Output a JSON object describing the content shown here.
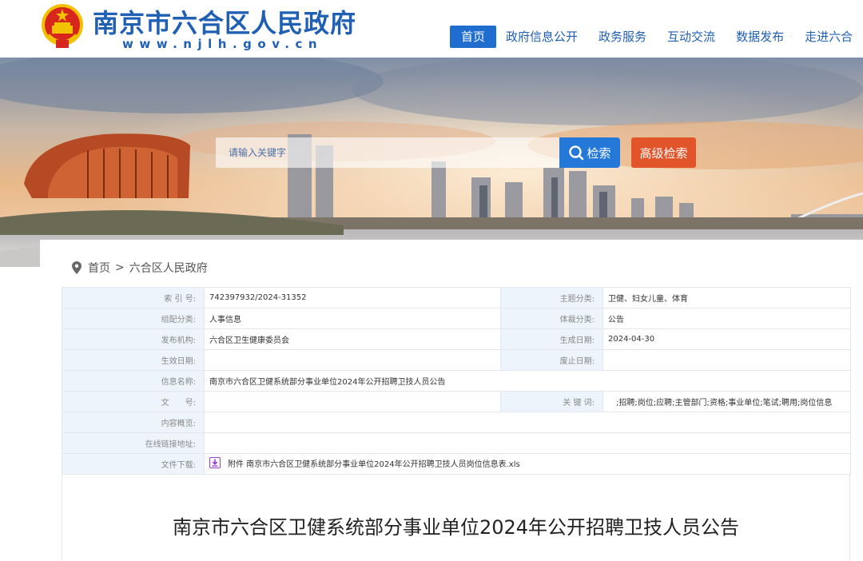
{
  "header": {
    "title": "南京市六合区人民政府",
    "url": "www.njlh.gov.cn"
  },
  "nav": [
    {
      "label": "首页",
      "active": true
    },
    {
      "label": "政府信息公开"
    },
    {
      "label": "政务服务"
    },
    {
      "label": "互动交流"
    },
    {
      "label": "数据发布"
    },
    {
      "label": "走进六合"
    }
  ],
  "search": {
    "placeholder": "请输入关键字",
    "button_label": "检索",
    "advanced_label": "高级检索"
  },
  "breadcrumb": {
    "home": "首页",
    "separator": ">",
    "current": "六合区人民政府"
  },
  "meta": {
    "index_label": "索 引 号:",
    "index_value": "742397932/2024-31352",
    "topic_label": "主题分类:",
    "topic_value": "卫健、妇女儿童、体育",
    "group_label": "组配分类:",
    "group_value": "人事信息",
    "genre_label": "体裁分类:",
    "genre_value": "公告",
    "issuer_label": "发布机构:",
    "issuer_value": "六合区卫生健康委员会",
    "created_label": "生成日期:",
    "created_value": "2024-04-30",
    "effective_label": "生效日期:",
    "effective_value": "",
    "repeal_label": "废止日期:",
    "repeal_value": "",
    "name_label": "信息名称:",
    "name_value": "南京市六合区卫健系统部分事业单位2024年公开招聘卫技人员公告",
    "docno_label": "文　　号:",
    "docno_value": "",
    "keywords_label": "关 键 词:",
    "keywords_value": ";招聘;岗位;应聘;主管部门;资格;事业单位;笔试;聘用;岗位信息",
    "summary_label": "内容概览:",
    "summary_value": "",
    "link_label": "在线链接地址:",
    "link_value": "",
    "download_label": "文件下载:",
    "download_value": "附件 南京市六合区卫健系统部分事业单位2024年公开招聘卫技人员岗位信息表.xls"
  },
  "article": {
    "title": "南京市六合区卫健系统部分事业单位2024年公开招聘卫技人员公告"
  },
  "colors": {
    "brand_blue": "#1f5fb4",
    "nav_active": "#1f6ecf",
    "search_button": "#2378d8",
    "advanced_button": "#e2542a",
    "label_cell": "#eef4fb"
  },
  "icons": [
    "national-emblem-icon",
    "search-icon",
    "location-pin-icon",
    "download-file-icon"
  ]
}
